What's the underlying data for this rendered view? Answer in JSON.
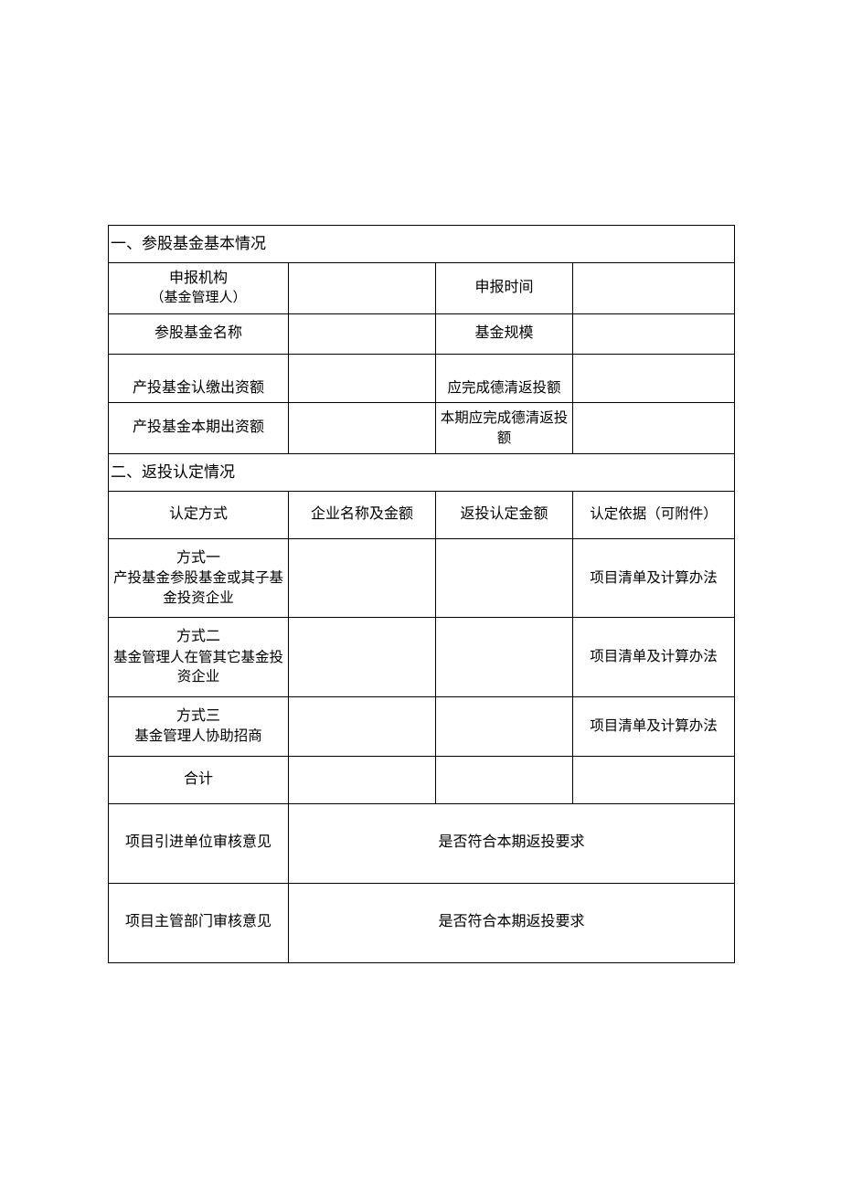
{
  "section1": {
    "header": "一、参股基金基本情况",
    "rows": [
      {
        "label_main": "申报机构",
        "label_sub": "（基金管理人）",
        "value1": "",
        "right_label": "申报时间",
        "value2": ""
      },
      {
        "label_main": "参股基金名称",
        "value1": "",
        "right_label": "基金规模",
        "value2": ""
      },
      {
        "label_main": "产投基金认缴出资额",
        "value1": "",
        "right_label": "应完成德清返投额",
        "value2": ""
      },
      {
        "label_main": "产投基金本期出资额",
        "value1": "",
        "right_label": "本期应完成德清返投额",
        "value2": ""
      }
    ]
  },
  "section2": {
    "header": "二、返投认定情况",
    "columns": [
      "认定方式",
      "企业名称及金额",
      "返投认定金额",
      "认定依据（可附件）"
    ],
    "methods": [
      {
        "title": "方式一",
        "desc": "产投基金参股基金或其子基金投资企业",
        "c2": "",
        "c3": "",
        "basis": "项目清单及计算办法"
      },
      {
        "title": "方式二",
        "desc": "基金管理人在管其它基金投资企业",
        "c2": "",
        "c3": "",
        "basis": "项目清单及计算办法"
      },
      {
        "title": "方式三",
        "desc": "基金管理人协助招商",
        "c2": "",
        "c3": "",
        "basis": "项目清单及计算办法"
      }
    ],
    "total_label": "合计",
    "review1": {
      "label": "项目引进单位审核意见",
      "text": "是否符合本期返投要求"
    },
    "review2": {
      "label": "项目主管部门审核意见",
      "text": "是否符合本期返投要求"
    }
  }
}
